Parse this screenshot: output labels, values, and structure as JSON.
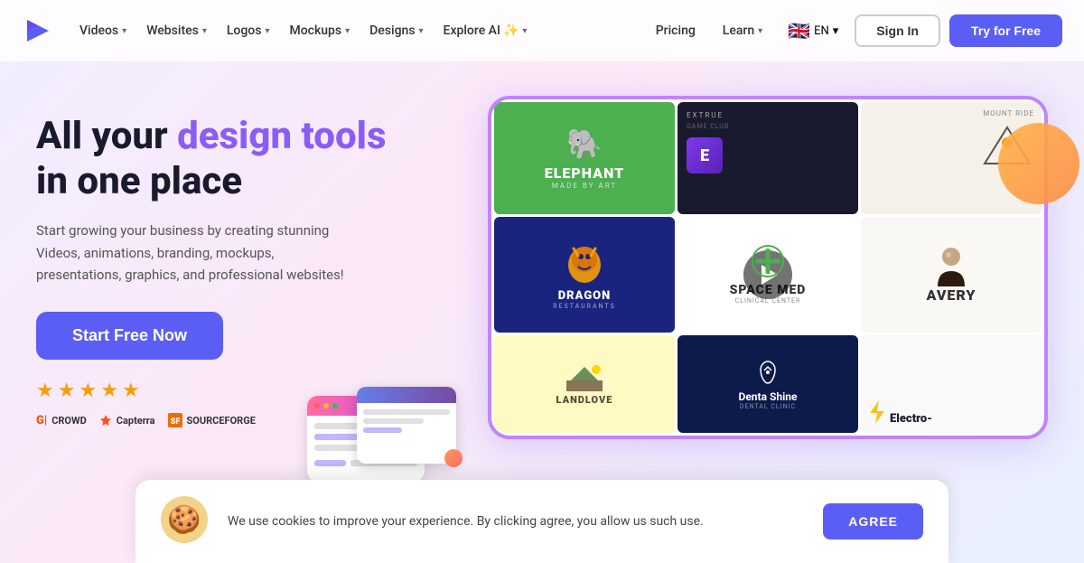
{
  "nav": {
    "logo_alt": "Renderforest",
    "items": [
      {
        "label": "Videos",
        "has_dropdown": true
      },
      {
        "label": "Websites",
        "has_dropdown": true
      },
      {
        "label": "Logos",
        "has_dropdown": true
      },
      {
        "label": "Mockups",
        "has_dropdown": true
      },
      {
        "label": "Designs",
        "has_dropdown": true
      },
      {
        "label": "Explore AI",
        "has_dropdown": true,
        "has_badge": true
      }
    ],
    "right_items": [
      {
        "label": "Pricing"
      },
      {
        "label": "Learn",
        "has_dropdown": true
      }
    ],
    "lang": "EN",
    "flag": "🇬🇧",
    "signin_label": "Sign In",
    "try_label": "Try for Free"
  },
  "hero": {
    "title_before": "All your ",
    "title_highlight": "design tools",
    "title_after": " in one place",
    "description": "Start growing your business by creating stunning Videos, animations, branding, mockups, presentations, graphics, and professional websites!",
    "cta_label": "Start Free Now",
    "stars": [
      "★",
      "★",
      "★",
      "★",
      "★"
    ],
    "social_proof": [
      {
        "icon": "G",
        "name": "CROWD",
        "prefix": "G|"
      },
      {
        "icon": "▶",
        "name": "Capterra"
      },
      {
        "icon": "SF",
        "name": "SOURCEFORGE"
      }
    ]
  },
  "logo_grid": {
    "cells": [
      {
        "type": "green",
        "name": "ELEPHANT",
        "subtitle": "MADE BY ART",
        "has_elephant": true
      },
      {
        "type": "dark",
        "name": "EXTRUE",
        "subtitle": "GAME CLUB"
      },
      {
        "type": "beige",
        "name": "MOUNT RIDE",
        "is_small": true
      },
      {
        "type": "darkblue",
        "name": "DRAGON",
        "subtitle": "RESTAURANTS"
      },
      {
        "type": "white",
        "name": "SPACE MED",
        "subtitle": "CLINICAL CENTER",
        "has_cross": true
      },
      {
        "type": "cream",
        "name": "AVERY",
        "has_figure": true
      },
      {
        "type": "yellow",
        "name": "LANDLOVE",
        "has_mountain": true
      },
      {
        "type": "darkblue2",
        "name": "Denta Shine",
        "subtitle": "DENTAL CLINIC"
      },
      {
        "type": "white2",
        "name": "Electro-",
        "has_bolt": true
      }
    ],
    "play_visible": true
  },
  "cookie": {
    "icon": "🍪",
    "message": "We use cookies to improve your experience. By clicking agree, you allow us such use.",
    "agree_label": "AGREE"
  }
}
